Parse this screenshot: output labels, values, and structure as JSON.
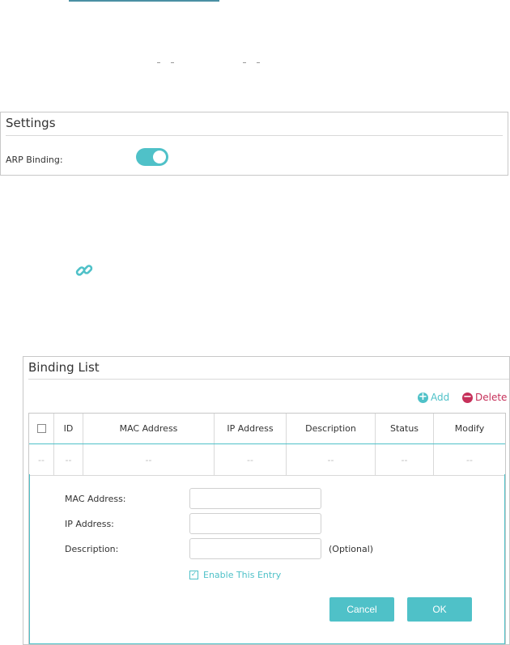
{
  "settings": {
    "title": "Settings",
    "arp_label": "ARP Binding:",
    "arp_enabled": true
  },
  "binding_list": {
    "title": "Binding List",
    "add_label": "Add",
    "delete_label": "Delete",
    "columns": [
      "ID",
      "MAC Address",
      "IP Address",
      "Description",
      "Status",
      "Modify"
    ],
    "empty_row": [
      "--",
      "--",
      "--",
      "--",
      "--",
      "--",
      "--"
    ],
    "form": {
      "mac_label": "MAC Address:",
      "ip_label": "IP Address:",
      "desc_label": "Description:",
      "optional_label": "(Optional)",
      "mac_value": "",
      "ip_value": "",
      "desc_value": "",
      "enable_label": "Enable This Entry",
      "enable_checked": true,
      "cancel_label": "Cancel",
      "ok_label": "OK"
    }
  },
  "colors": {
    "accent": "#4fc1c8",
    "delete": "#c6305a"
  },
  "icons": {
    "link": "link-icon",
    "add": "plus-circle-icon",
    "delete": "minus-circle-icon"
  }
}
